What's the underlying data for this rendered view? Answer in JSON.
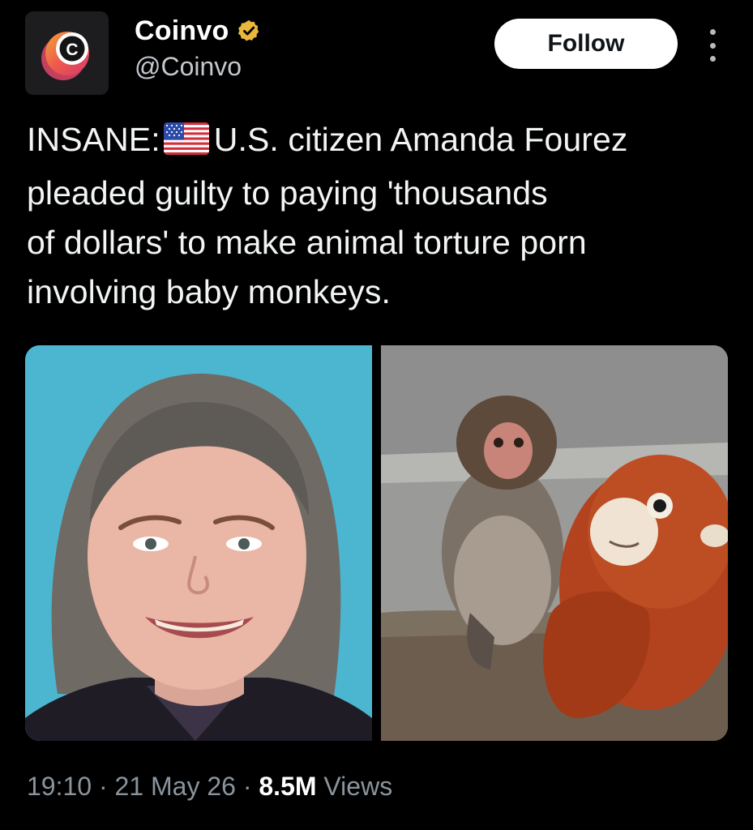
{
  "author": {
    "display_name": "Coinvo",
    "handle": "@Coinvo",
    "avatar_letter": "C",
    "verified": true,
    "verified_color": "#e8b73b"
  },
  "actions": {
    "follow_label": "Follow",
    "more_icon": "more-vertical-icon"
  },
  "tweet": {
    "prefix": "INSANE:",
    "flag_icon": "us-flag-emoji",
    "lines": [
      "U.S. citizen Amanda Fourez",
      "pleaded guilty to paying 'thousands",
      "of dollars' to make animal torture porn",
      "involving baby monkeys."
    ]
  },
  "media": {
    "images": [
      {
        "name": "woman-photo"
      },
      {
        "name": "monkey-photo"
      }
    ]
  },
  "meta": {
    "time": "19:10",
    "separator": "·",
    "date": "21 May 26",
    "views_count": "8.5M",
    "views_label": "Views"
  },
  "colors": {
    "background": "#000000",
    "text": "#e7e9ea",
    "muted": "#8b949c",
    "follow_bg": "#ffffff"
  }
}
